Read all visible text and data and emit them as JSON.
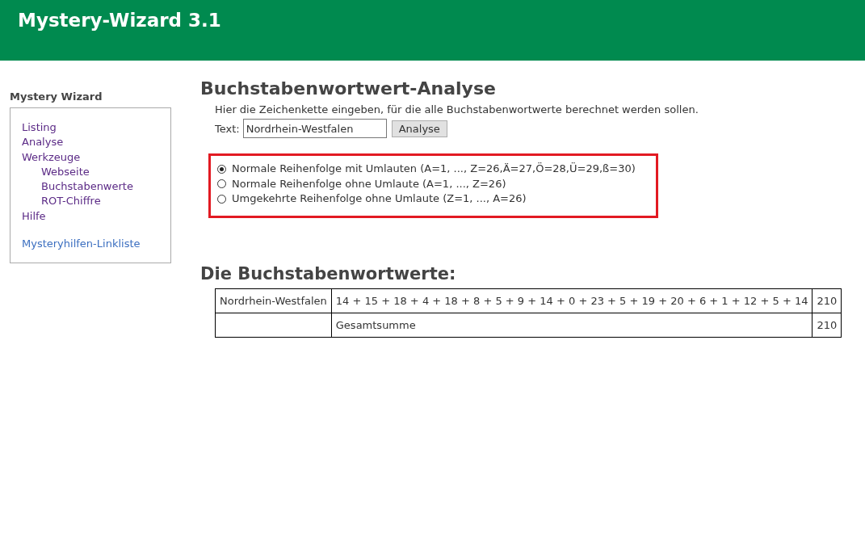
{
  "header": {
    "title": "Mystery-Wizard 3.1"
  },
  "sidebar": {
    "title": "Mystery Wizard",
    "items": [
      {
        "label": "Listing",
        "visited": true
      },
      {
        "label": "Analyse",
        "visited": true
      },
      {
        "label": "Werkzeuge",
        "visited": true,
        "children": [
          {
            "label": "Webseite",
            "visited": true
          },
          {
            "label": "Buchstabenwerte",
            "visited": true
          },
          {
            "label": "ROT-Chiffre",
            "visited": true
          }
        ]
      },
      {
        "label": "Hilfe",
        "visited": true
      }
    ],
    "extra_link": {
      "label": "Mysteryhilfen-Linkliste",
      "visited": false
    }
  },
  "main": {
    "title": "Buchstabenwortwert-Analyse",
    "description": "Hier die Zeichenkette eingeben, für die alle Buchstabenwortwerte berechnet werden sollen.",
    "field_label": "Text:",
    "field_value": "Nordrhein-Westfalen",
    "button": "Analyse",
    "options": [
      {
        "label": "Normale Reihenfolge mit Umlauten (A=1, ..., Z=26,Ä=27,Ö=28,Ü=29,ß=30)",
        "selected": true
      },
      {
        "label": "Normale Reihenfolge ohne Umlaute (A=1, ..., Z=26)",
        "selected": false
      },
      {
        "label": "Umgekehrte Reihenfolge ohne Umlaute (Z=1, ..., A=26)",
        "selected": false
      }
    ]
  },
  "results": {
    "title": "Die Buchstabenwortwerte:",
    "rows": [
      {
        "word": "Nordrhein-Westfalen",
        "terms": "14 + 15 + 18 + 4 + 18 + 8 + 5 + 9 + 14 + 0 + 23 + 5 + 19 + 20 + 6 + 1 + 12 + 5 + 14",
        "sum": "210"
      }
    ],
    "total": {
      "label": "Gesamtsumme",
      "sum": "210"
    }
  }
}
